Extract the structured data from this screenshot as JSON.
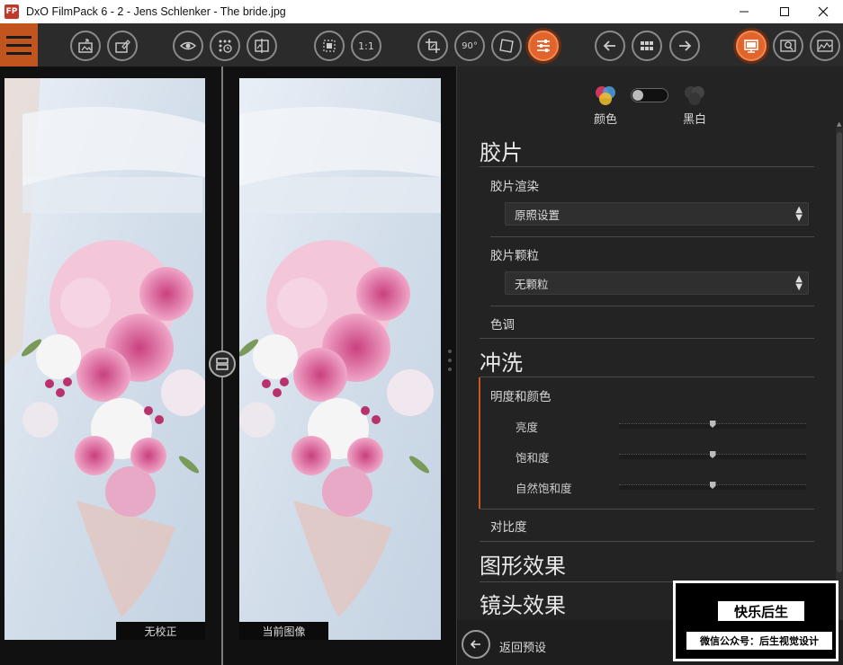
{
  "window": {
    "app_icon": "FP",
    "title": "DxO FilmPack 6 - 2 - Jens Schlenker - The bride.jpg",
    "controls": [
      "minimize-icon",
      "maximize-icon",
      "close-icon"
    ]
  },
  "toolbar": {
    "icons": [
      "menu-icon",
      "export-icon",
      "edit-image-icon",
      "preview-eye-icon",
      "history-grid-icon",
      "compare-icon",
      "fit-screen-icon",
      "zoom-one-to-one-icon",
      "crop-icon",
      "rotate-90-icon",
      "straighten-icon",
      "adjustments-icon",
      "previous-icon",
      "grid-view-icon",
      "next-icon",
      "monitor-icon",
      "loupe-icon",
      "histogram-icon"
    ],
    "zoom_label": "1:1",
    "rotate_label": "90°",
    "accent_color": "#e0642c"
  },
  "viewer": {
    "left_caption": "无校正",
    "right_caption": "当前图像"
  },
  "panel": {
    "color_mode_label": "颜色",
    "bw_mode_label": "黑白",
    "film_section": "胶片",
    "film_rendering_label": "胶片渲染",
    "film_rendering_value": "原照设置",
    "film_grain_label": "胶片颗粒",
    "film_grain_value": "无颗粒",
    "tone_label": "色调",
    "develop_section": "冲洗",
    "lightness_color_label": "明度和颜色",
    "sliders": [
      {
        "label": "亮度",
        "value": 0.5
      },
      {
        "label": "饱和度",
        "value": 0.5
      },
      {
        "label": "自然饱和度",
        "value": 0.5
      }
    ],
    "contrast_label": "对比度",
    "graphic_effects_section": "图形效果",
    "lens_effects_section": "镜头效果",
    "back_label": "返回预设"
  },
  "watermark": {
    "title": "快乐后生",
    "subtitle": "微信公众号：后生视觉设计"
  }
}
